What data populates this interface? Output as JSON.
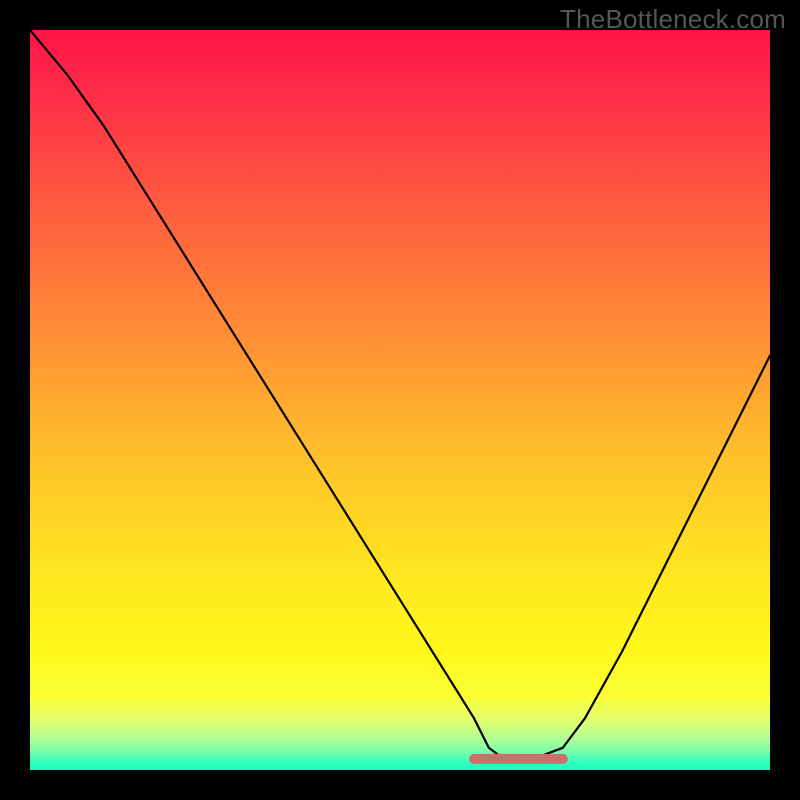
{
  "watermark": "TheBottleneck.com",
  "colors": {
    "frame": "#000000",
    "marker": "#cc6e69",
    "curve": "#000000"
  },
  "chart_data": {
    "type": "line",
    "title": "",
    "xlabel": "",
    "ylabel": "",
    "xlim": [
      0,
      100
    ],
    "ylim": [
      0,
      100
    ],
    "grid": false,
    "legend": false,
    "series": [
      {
        "name": "bottleneck-curve",
        "x": [
          0,
          5,
          10,
          15,
          20,
          25,
          30,
          35,
          40,
          45,
          50,
          55,
          60,
          62,
          64,
          68,
          72,
          75,
          80,
          85,
          90,
          95,
          100
        ],
        "y": [
          100,
          94,
          87,
          79,
          71,
          63,
          55,
          47,
          39,
          31,
          23,
          15,
          7,
          3,
          1.5,
          1.5,
          3,
          7,
          16,
          26,
          36,
          46,
          56
        ]
      }
    ],
    "marker": {
      "name": "optimal-range",
      "x_start": 60,
      "x_end": 72,
      "y": 1.5
    },
    "background_gradient": {
      "stops": [
        {
          "pos": 0,
          "color": "#ff1449"
        },
        {
          "pos": 50,
          "color": "#ffc12a"
        },
        {
          "pos": 85,
          "color": "#fff81a"
        },
        {
          "pos": 100,
          "color": "#18ffbf"
        }
      ]
    }
  }
}
